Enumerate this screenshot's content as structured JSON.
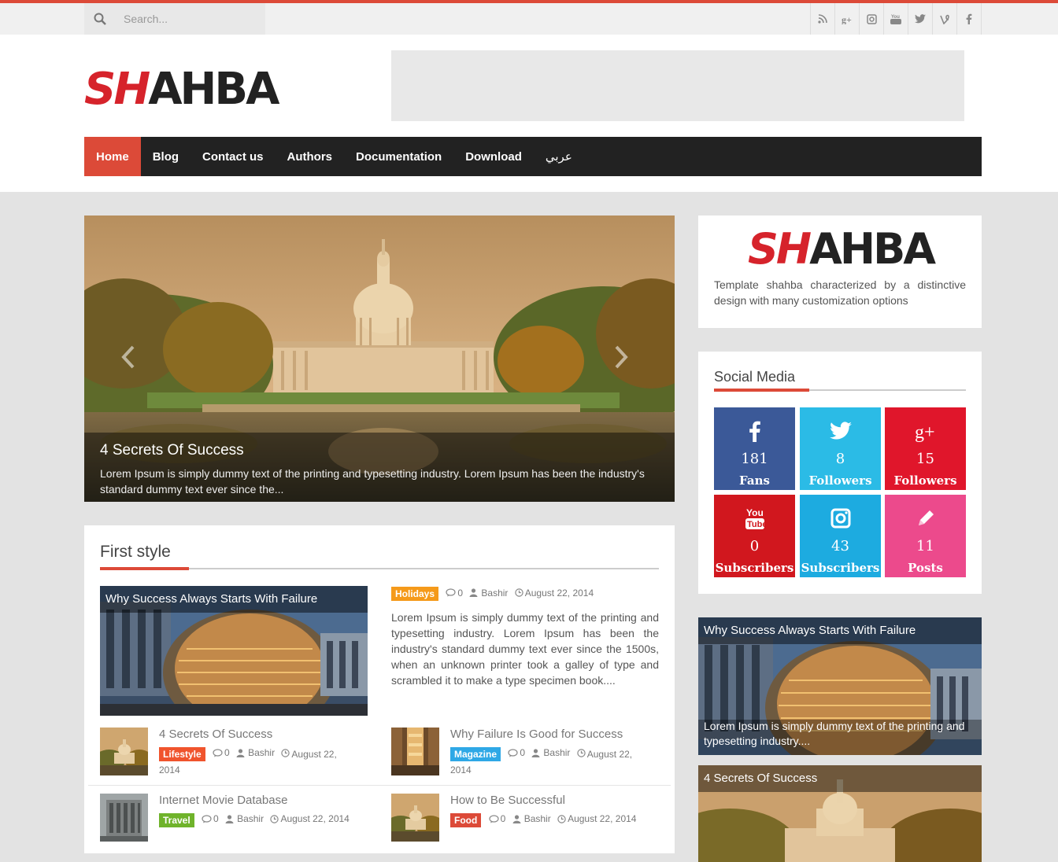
{
  "topbar": {
    "search_placeholder": "Search...",
    "social_icons": [
      "rss-icon",
      "google-plus-icon",
      "instagram-icon",
      "youtube-icon",
      "twitter-icon",
      "vine-icon",
      "facebook-icon"
    ]
  },
  "logo": {
    "part1": "SH",
    "part2": "AHBA"
  },
  "nav": {
    "items": [
      {
        "label": "Home",
        "active": true
      },
      {
        "label": "Blog"
      },
      {
        "label": "Contact us"
      },
      {
        "label": "Authors"
      },
      {
        "label": "Documentation"
      },
      {
        "label": "Download"
      },
      {
        "label": "عربي"
      }
    ]
  },
  "slider": {
    "title": "4 Secrets Of Success",
    "description": "Lorem Ipsum is simply dummy text of the printing and typesetting industry. Lorem Ipsum has been the industry's standard dummy text ever since the..."
  },
  "first_style": {
    "title": "First style",
    "featured": {
      "title": "Why Success Always Starts With Failure",
      "category": "Holidays",
      "comments": "0",
      "author": "Bashir",
      "date": "August 22, 2014",
      "excerpt": "Lorem Ipsum is simply dummy text of the printing and typesetting industry. Lorem Ipsum has been the industry's standard dummy text ever since the 1500s, when an unknown printer took a galley of type and scrambled it to make a type specimen book...."
    },
    "posts": [
      {
        "title": "4 Secrets Of Success",
        "category": "Lifestyle",
        "cat_color": "#f0542d",
        "comments": "0",
        "author": "Bashir",
        "date": "August 22, 2014"
      },
      {
        "title": "Why Failure Is Good for Success",
        "category": "Magazine",
        "cat_color": "#2fa8e6",
        "comments": "0",
        "author": "Bashir",
        "date": "August 22, 2014"
      },
      {
        "title": "Internet Movie Database",
        "category": "Travel",
        "cat_color": "#6fb32b",
        "comments": "0",
        "author": "Bashir",
        "date": "August 22, 2014"
      },
      {
        "title": "How to Be Successful",
        "category": "Food",
        "cat_color": "#dc4a38",
        "comments": "0",
        "author": "Bashir",
        "date": "August 22, 2014"
      }
    ]
  },
  "about_widget": {
    "logo_part1": "SH",
    "logo_part2": "AHBA",
    "text": "Template shahba characterized by a distinctive design with many customization options"
  },
  "social_widget": {
    "title": "Social Media",
    "boxes": [
      {
        "icon": "facebook-icon",
        "count": "181",
        "label": "Fans",
        "color": "#3b5998"
      },
      {
        "icon": "twitter-icon",
        "count": "8",
        "label": "Followers",
        "color": "#2bbbe6"
      },
      {
        "icon": "google-plus-icon",
        "count": "15",
        "label": "Followers",
        "color": "#e0162b"
      },
      {
        "icon": "youtube-icon",
        "count": "0",
        "label": "Subscribers",
        "color": "#d1171e"
      },
      {
        "icon": "instagram-icon",
        "count": "43",
        "label": "Subscribers",
        "color": "#1dabe0"
      },
      {
        "icon": "pencil-icon",
        "count": "11",
        "label": "Posts",
        "color": "#ec4a8c"
      }
    ]
  },
  "sidebar_posts": [
    {
      "title": "Why Success Always Starts With Failure",
      "excerpt": "Lorem Ipsum is simply dummy text of the printing and typesetting industry...."
    },
    {
      "title": "4 Secrets Of Success"
    }
  ]
}
